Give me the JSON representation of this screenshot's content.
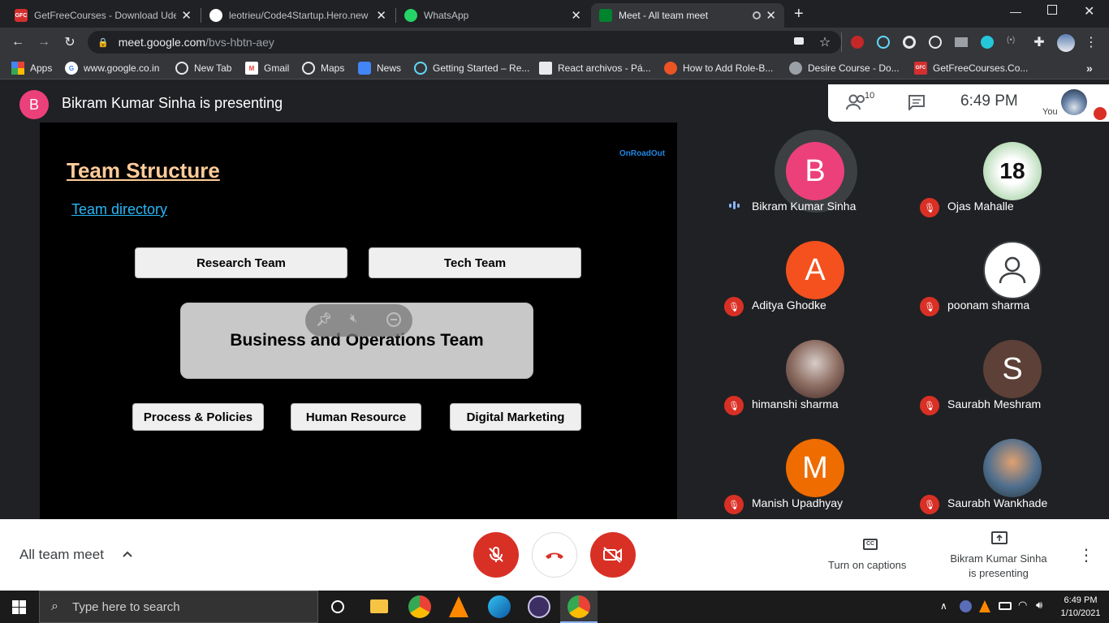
{
  "browser": {
    "tabs": [
      {
        "label": "GetFreeCourses - Download Ude",
        "favicon": "GFC"
      },
      {
        "label": "leotrieu/Code4Startup.Hero.new"
      },
      {
        "label": "WhatsApp"
      },
      {
        "label": "Meet - All team meet",
        "active": true
      }
    ],
    "url_host": "meet.google.com",
    "url_path": "/bvs-hbtn-aey",
    "bookmarks": [
      "Apps",
      "www.google.co.in",
      "New Tab",
      "Gmail",
      "Maps",
      "News",
      "Getting Started – Re...",
      "React archivos - Pá...",
      "How to Add Role-B...",
      "Desire Course - Do...",
      "GetFreeCourses.Co..."
    ],
    "more_bookmarks": "»"
  },
  "meet": {
    "presenter_initial": "B",
    "presenter_text": "Bikram Kumar Sinha is presenting",
    "participant_count": "10",
    "time": "6:49 PM",
    "you_label": "You",
    "meeting_name": "All team meet",
    "captions_label": "Turn on captions",
    "presenting_label_line1": "Bikram Kumar Sinha",
    "presenting_label_line2": "is presenting"
  },
  "slide": {
    "brand": "OnRoadOut",
    "title": "Team Structure",
    "link": "Team directory",
    "boxes": {
      "research": "Research Team",
      "tech": "Tech Team",
      "business": "Business and Operations Team",
      "process": "Process & Policies",
      "hr": "Human Resource",
      "marketing": "Digital Marketing"
    }
  },
  "participants": [
    {
      "name": "Bikram Kumar Sinha",
      "initial": "B",
      "color": "#ec407a",
      "speaking": true
    },
    {
      "name": "Ojas Mahalle",
      "initial": "18",
      "color": "#9ccc9c",
      "muted": true
    },
    {
      "name": "Aditya Ghodke",
      "initial": "A",
      "color": "#f4511e",
      "muted": true
    },
    {
      "name": "poonam sharma",
      "initial": "",
      "color": "#ffffff",
      "muted": true
    },
    {
      "name": "himanshi sharma",
      "initial": "",
      "color": "#8d6e63",
      "muted": true
    },
    {
      "name": "Saurabh Meshram",
      "initial": "S",
      "color": "#5d4037",
      "muted": true
    },
    {
      "name": "Manish Upadhyay",
      "initial": "M",
      "color": "#ef6c00",
      "muted": true
    },
    {
      "name": "Saurabh Wankhade",
      "initial": "",
      "color": "#4e6e8e",
      "muted": true
    }
  ],
  "taskbar": {
    "search_placeholder": "Type here to search",
    "time": "6:49 PM",
    "date": "1/10/2021"
  }
}
